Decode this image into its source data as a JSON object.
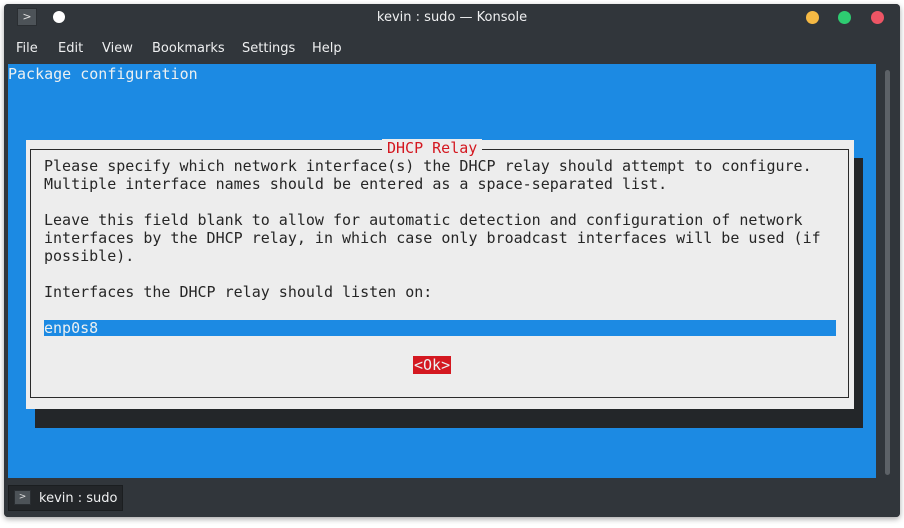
{
  "window": {
    "title": "kevin : sudo — Konsole",
    "icon": "terminal-icon",
    "controls": [
      "minimize-button",
      "maximize-button",
      "close-button"
    ]
  },
  "menubar": {
    "items": [
      "File",
      "Edit",
      "View",
      "Bookmarks",
      "Settings",
      "Help"
    ]
  },
  "terminal": {
    "header": "Package configuration",
    "dialog": {
      "title": "DHCP Relay",
      "lines": [
        "Please specify which network interface(s) the DHCP relay should attempt to configure.",
        "Multiple interface names should be entered as a space-separated list.",
        "Leave this field blank to allow for automatic detection and configuration of network",
        "interfaces by the DHCP relay, in which case only broadcast interfaces will be used (if",
        "possible).",
        "Interfaces the DHCP relay should listen on:"
      ],
      "input_value": "enp0s8",
      "input_fill": "_______________________________________________________________________________",
      "ok_label": "<Ok>"
    }
  },
  "tabs": [
    {
      "label": "kevin : sudo",
      "icon": "terminal-icon"
    }
  ],
  "colors": {
    "terminal_bg": "#1c8ae3",
    "dialog_bg": "#ededed",
    "accent_red": "#d41820",
    "chrome": "#31363b"
  }
}
